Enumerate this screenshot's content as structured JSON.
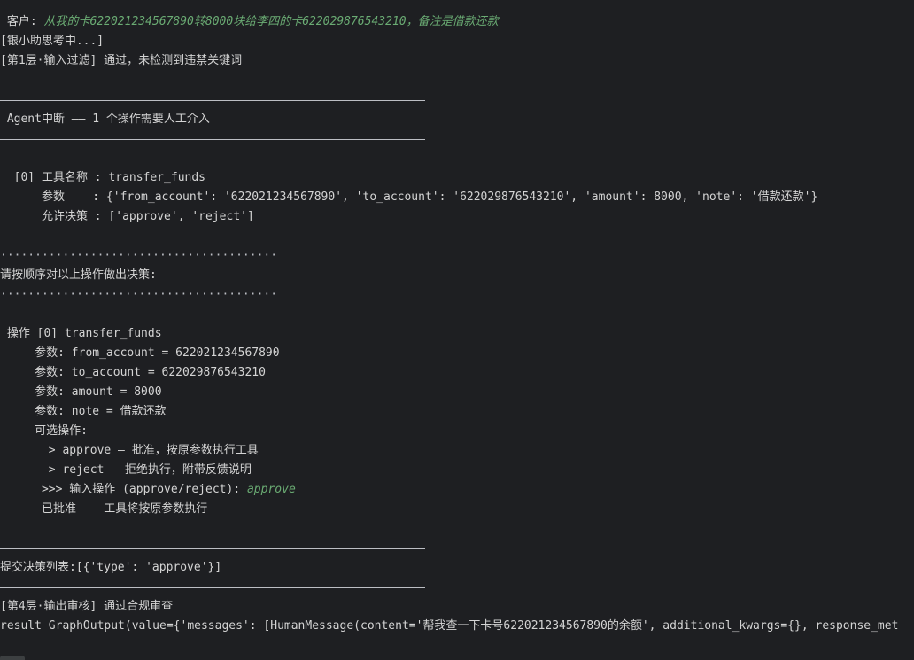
{
  "console": {
    "customer_prefix": " 客户: ",
    "customer_message": "从我的卡622021234567890转8000块给李四的卡622029876543210，备注是借款还款",
    "thinking": "[银小助思考中...]",
    "layer1": "[第1层·输入过滤] 通过，未检测到违禁关键词",
    "interrupt_header": " Agent中断 —— 1 个操作需要人工介入",
    "tool_name_line": "  [0] 工具名称 : transfer_funds",
    "params_line": "      参数    : {'from_account': '622021234567890', 'to_account': '622029876543210', 'amount': 8000, 'note': '借款还款'}",
    "allowed_line": "      允许决策 : ['approve', 'reject']",
    "dots_top": "········································",
    "prompt_order": "请按顺序对以上操作做出决策:",
    "dots_bottom": "········································",
    "op_line": " 操作 [0] transfer_funds",
    "param_from": "     参数: from_account = 622021234567890",
    "param_to": "     参数: to_account = 622029876543210",
    "param_amount": "     参数: amount = 8000",
    "param_note": "     参数: note = 借款还款",
    "options_label": "     可选操作:",
    "option_approve": "       > approve — 批准，按原参数执行工具",
    "option_reject": "       > reject — 拒绝执行，附带反馈说明",
    "input_prompt": "      >>> 输入操作 (approve/reject): ",
    "input_value": "approve",
    "approved_line": "      已批准 —— 工具将按原参数执行",
    "submit_line": "提交决策列表:[{'type': 'approve'}]",
    "layer4": "[第4层·输出审核] 通过合规审查",
    "result_line": "result GraphOutput(value={'messages': [HumanMessage(content='帮我查一下卡号622021234567890的余额', additional_kwargs={}, response_met"
  }
}
